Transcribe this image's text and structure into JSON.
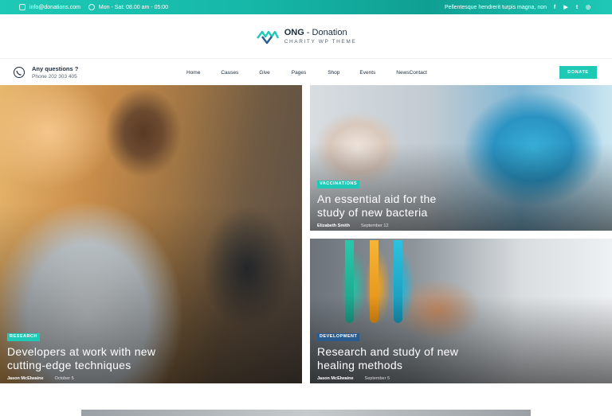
{
  "topbar": {
    "email": "info@donations.com",
    "hours": "Mon - Sat: 08.00 am - 05:00",
    "tagline": "Pellentesque hendrerit turpis magna, non",
    "social": [
      "f",
      "▶",
      "t",
      "◎"
    ]
  },
  "logo": {
    "brand": "ONG",
    "separator": " - ",
    "name": "Donation",
    "subtitle": "CHARITY WP THEME"
  },
  "nav": {
    "questions_label": "Any questions ?",
    "phone": "Phone 202 303 405",
    "items": [
      "Home",
      "Causes",
      "Give",
      "Pages",
      "Shop",
      "Events",
      "News",
      "Contact"
    ],
    "donate_label": "DONATE"
  },
  "posts": [
    {
      "category": "RESEARCH",
      "title_line1": "Developers at work with new",
      "title_line2": "cutting-edge techniques",
      "author": "Jason McElwaine",
      "date": "October 5"
    },
    {
      "category": "VACCINATIONS",
      "title_line1": "An essential aid for the",
      "title_line2": "study of new bacteria",
      "author": "Elizabeth Smith",
      "date": "September 12"
    },
    {
      "category": "DEVELOPMENT",
      "title_line1": "Research and study of new",
      "title_line2": "healing methods",
      "author": "Jason McElwaine",
      "date": "September 5"
    }
  ],
  "colors": {
    "accent": "#1ec9b6",
    "research_badge": "#1ec9b6",
    "vaccinations_badge": "#1ec9b6",
    "development_badge": "#2a5d8f"
  }
}
